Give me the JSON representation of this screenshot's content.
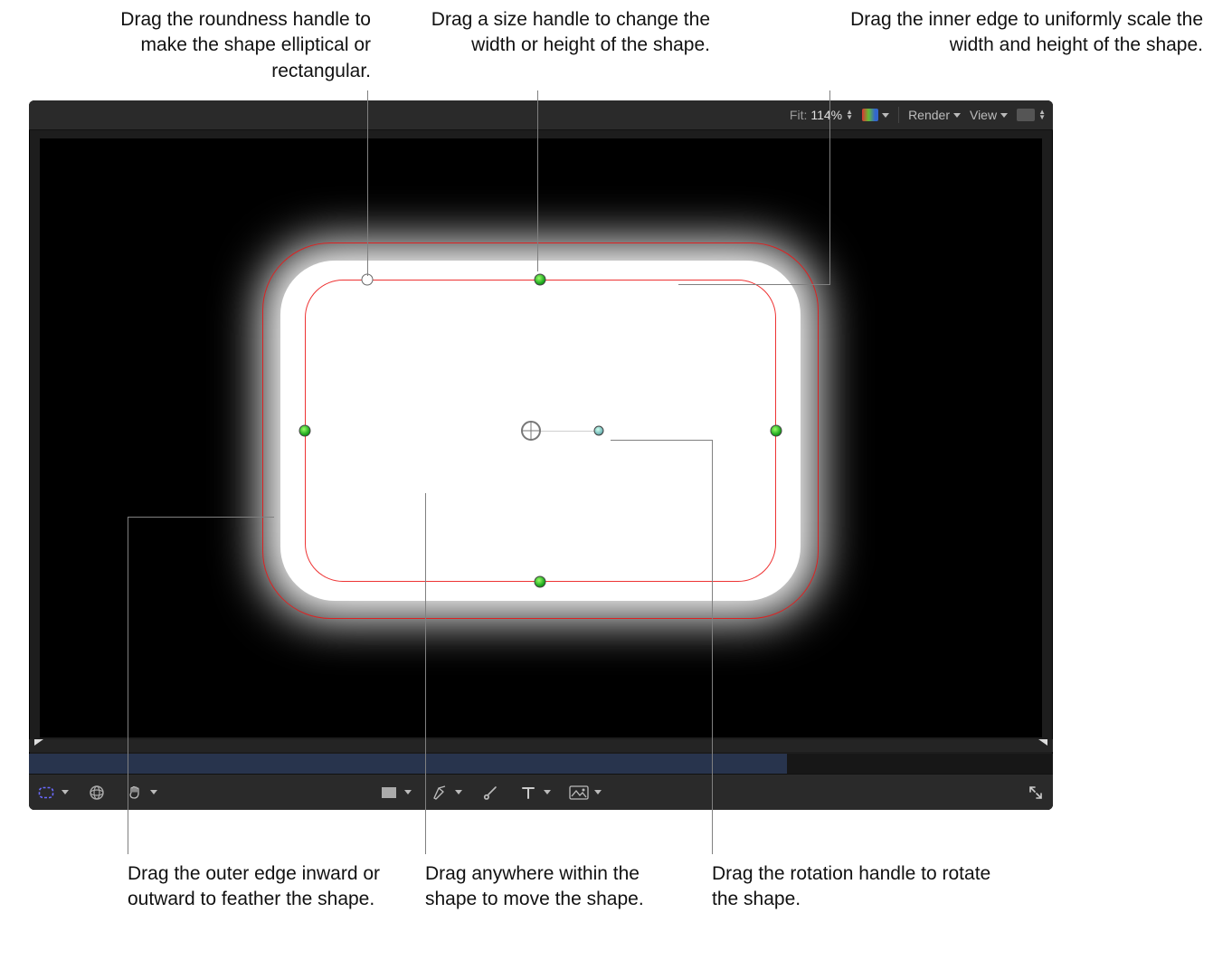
{
  "callouts": {
    "roundness": "Drag the roundness handle to make the shape elliptical or rectangular.",
    "size": "Drag a size handle to change the width or height of the shape.",
    "inner_edge": "Drag the inner edge to uniformly scale the width and height of the shape.",
    "outer_edge": "Drag the outer edge inward or outward to feather the shape.",
    "move": "Drag anywhere within the shape to move the shape.",
    "rotation": "Drag the rotation handle to rotate the shape."
  },
  "titlebar": {
    "fit_label": "Fit:",
    "fit_value": "114%",
    "render_label": "Render",
    "view_label": "View"
  }
}
